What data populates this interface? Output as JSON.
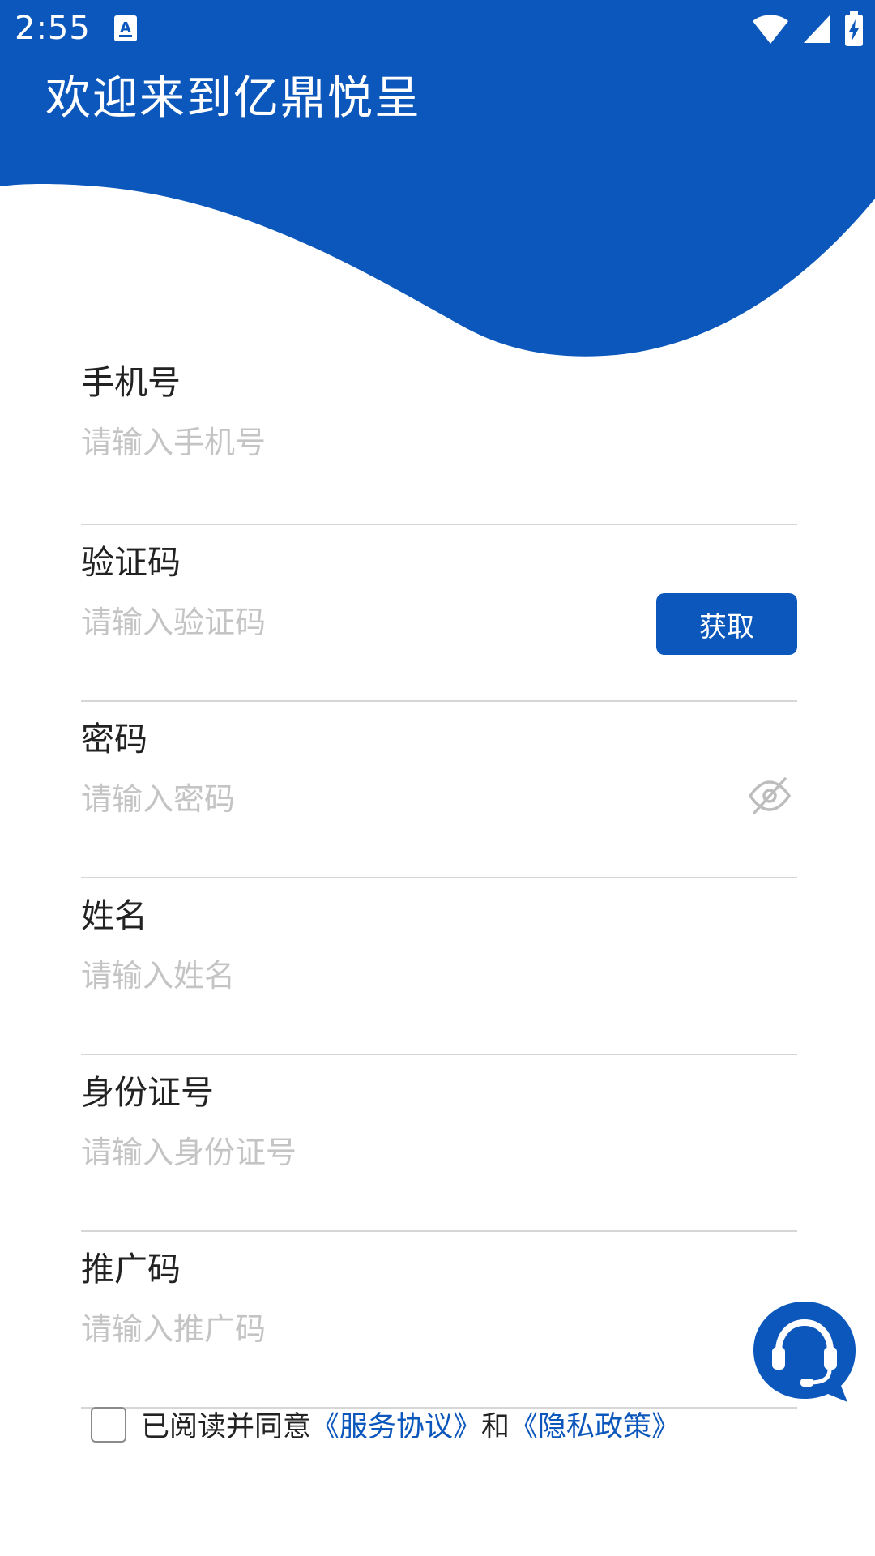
{
  "status_bar": {
    "time": "2:55",
    "notification_icon": "a-box-icon",
    "wifi_icon": "wifi-icon",
    "signal_icon": "signal-icon",
    "battery_icon": "battery-charging-icon"
  },
  "header": {
    "title": "欢迎来到亿鼎悦呈",
    "color": "#0c57bb"
  },
  "form": {
    "phone": {
      "label": "手机号",
      "placeholder": "请输入手机号"
    },
    "code": {
      "label": "验证码",
      "placeholder": "请输入验证码",
      "button": "获取"
    },
    "password": {
      "label": "密码",
      "placeholder": "请输入密码",
      "toggle_icon": "eye-off-icon"
    },
    "name": {
      "label": "姓名",
      "placeholder": "请输入姓名"
    },
    "id_number": {
      "label": "身份证号",
      "placeholder": "请输入身份证号"
    },
    "referral": {
      "label": "推广码",
      "placeholder": "请输入推广码"
    }
  },
  "agreement": {
    "prefix": "已阅读并同意",
    "service_link": "《服务协议》",
    "and": "和",
    "privacy_link": "《隐私政策》",
    "checked": false
  },
  "support": {
    "icon": "headset-chat-icon"
  }
}
